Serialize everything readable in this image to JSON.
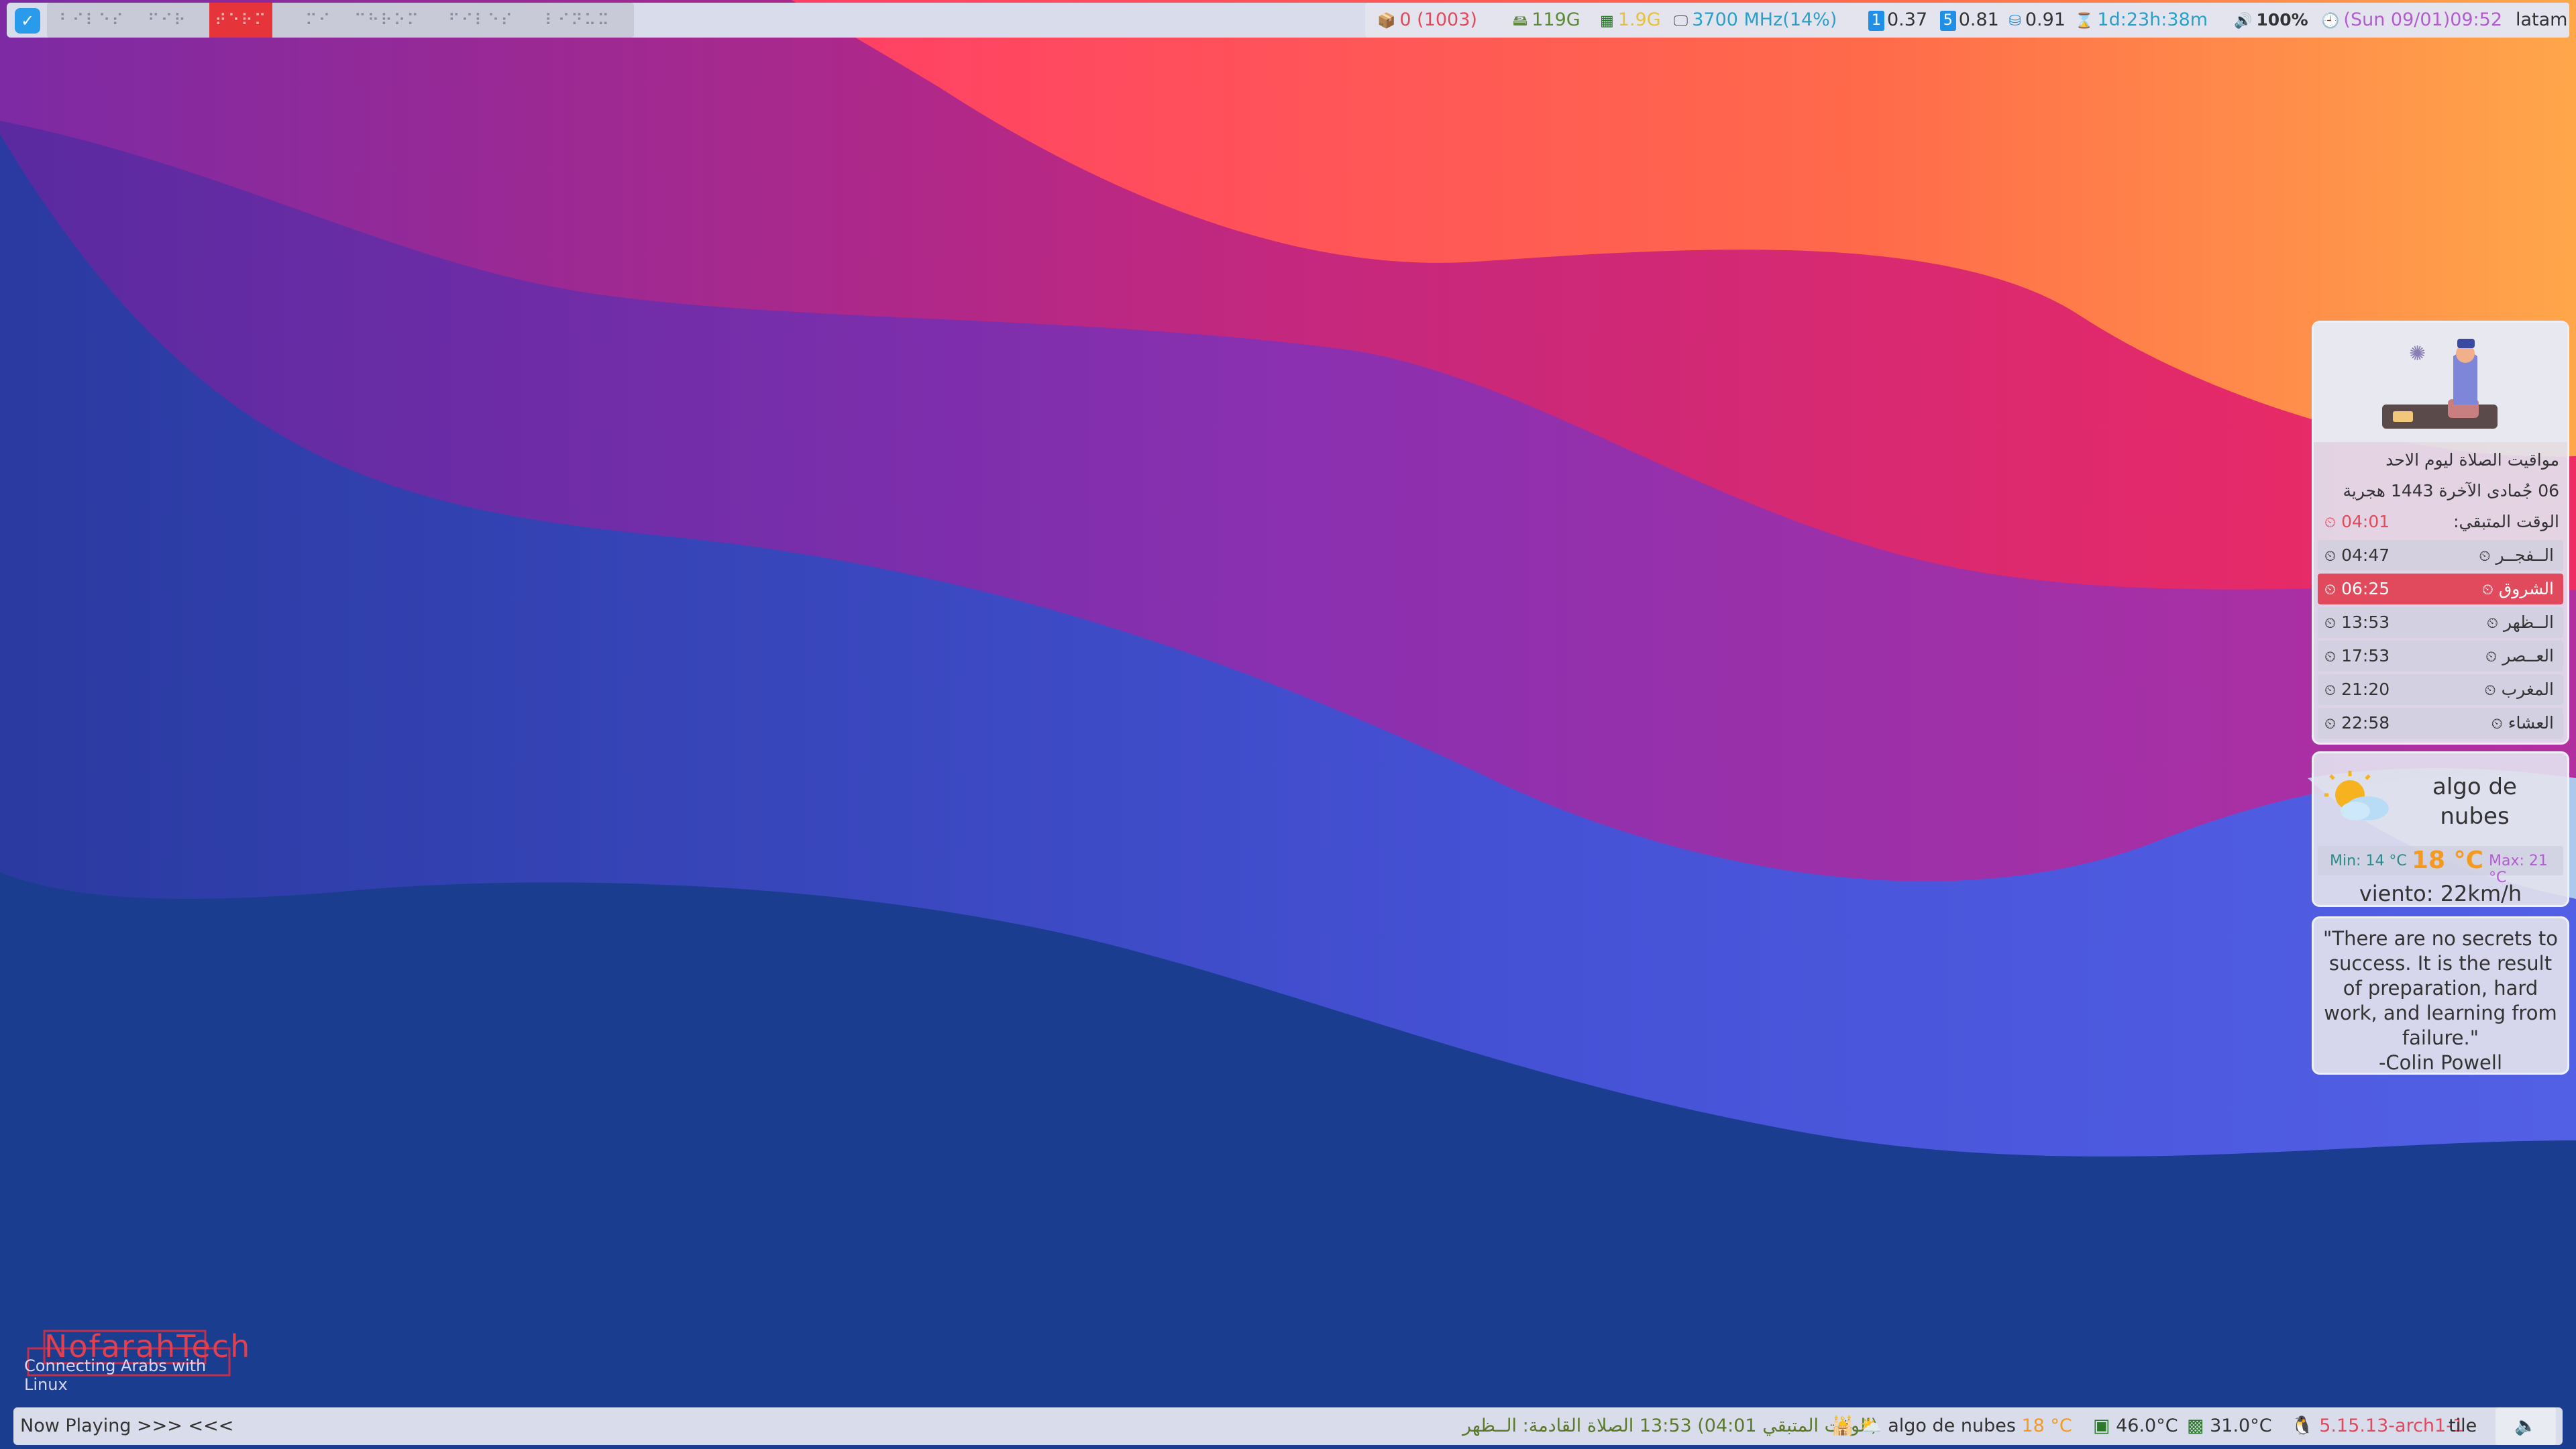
{
  "colors": {
    "bar_bg": "#d9dcea",
    "accent_red": "#e14a5c",
    "link_blue": "#2a9bea"
  },
  "topbar": {
    "workspaces": [
      "⠃⠊⠇⠑⠎",
      "⠋⠊⠗",
      "⠞⠑⠗⠍",
      "⠍⠊",
      "⠉⠓⠗⠕⠍",
      "⠋⠊⠇⠑⠎",
      "⠇⠊⠝⠥⠭"
    ],
    "active_index": 2,
    "status": {
      "updates": "0 (1003)",
      "disk": "119G",
      "mem": "1.9G",
      "cpu": "3700 MHz(14%)",
      "load1_badge": "1",
      "load1": "0.37",
      "load5_badge": "5",
      "load5": "0.81",
      "load15": "0.91",
      "uptime": "1d:23h:38m",
      "volume": "100%",
      "datetime": "(Sun 09/01)09:52",
      "keyboard": "latam"
    }
  },
  "prayer": {
    "title": "مواقيت الصلاة ليوم الاحد",
    "hijri": "06 جُمادى الآخرة 1443 هجرية",
    "remaining_label": "الوقت المتبقي:",
    "remaining": "04:01",
    "times": [
      {
        "name": "الــفجــر",
        "time": "04:47"
      },
      {
        "name": "الشروق",
        "time": "06:25"
      },
      {
        "name": "الــظهر",
        "time": "13:53"
      },
      {
        "name": "العــصر",
        "time": "17:53"
      },
      {
        "name": "المغرب",
        "time": "21:20"
      },
      {
        "name": "العشاء",
        "time": "22:58"
      }
    ],
    "highlight_index": 1
  },
  "weather": {
    "condition": "algo de nubes",
    "min": "Min: 14 °C",
    "current": "18 °C",
    "max": "Max: 21 °C",
    "wind": "viento: 22km/h"
  },
  "quote": {
    "text": "\"There are no secrets to success. It is the result of preparation, hard work, and learning from failure.\"",
    "author": "-Colin Powell"
  },
  "logo": {
    "name": "NofarahTech",
    "tagline": "Connecting Arabs with Linux"
  },
  "bottombar": {
    "now_playing": "Now Playing >>>  <<<",
    "prayer_next": "(الوقت المتبقي 04:01)  13:53  الصلاة القادمة: الــظهر",
    "weather": "algo de nubes",
    "weather_temp": "18 °C",
    "gpu_temp": "46.0°C",
    "cpu_temp": "31.0°C",
    "kernel": "5.15.13-arch1-1",
    "layout": "tile"
  }
}
